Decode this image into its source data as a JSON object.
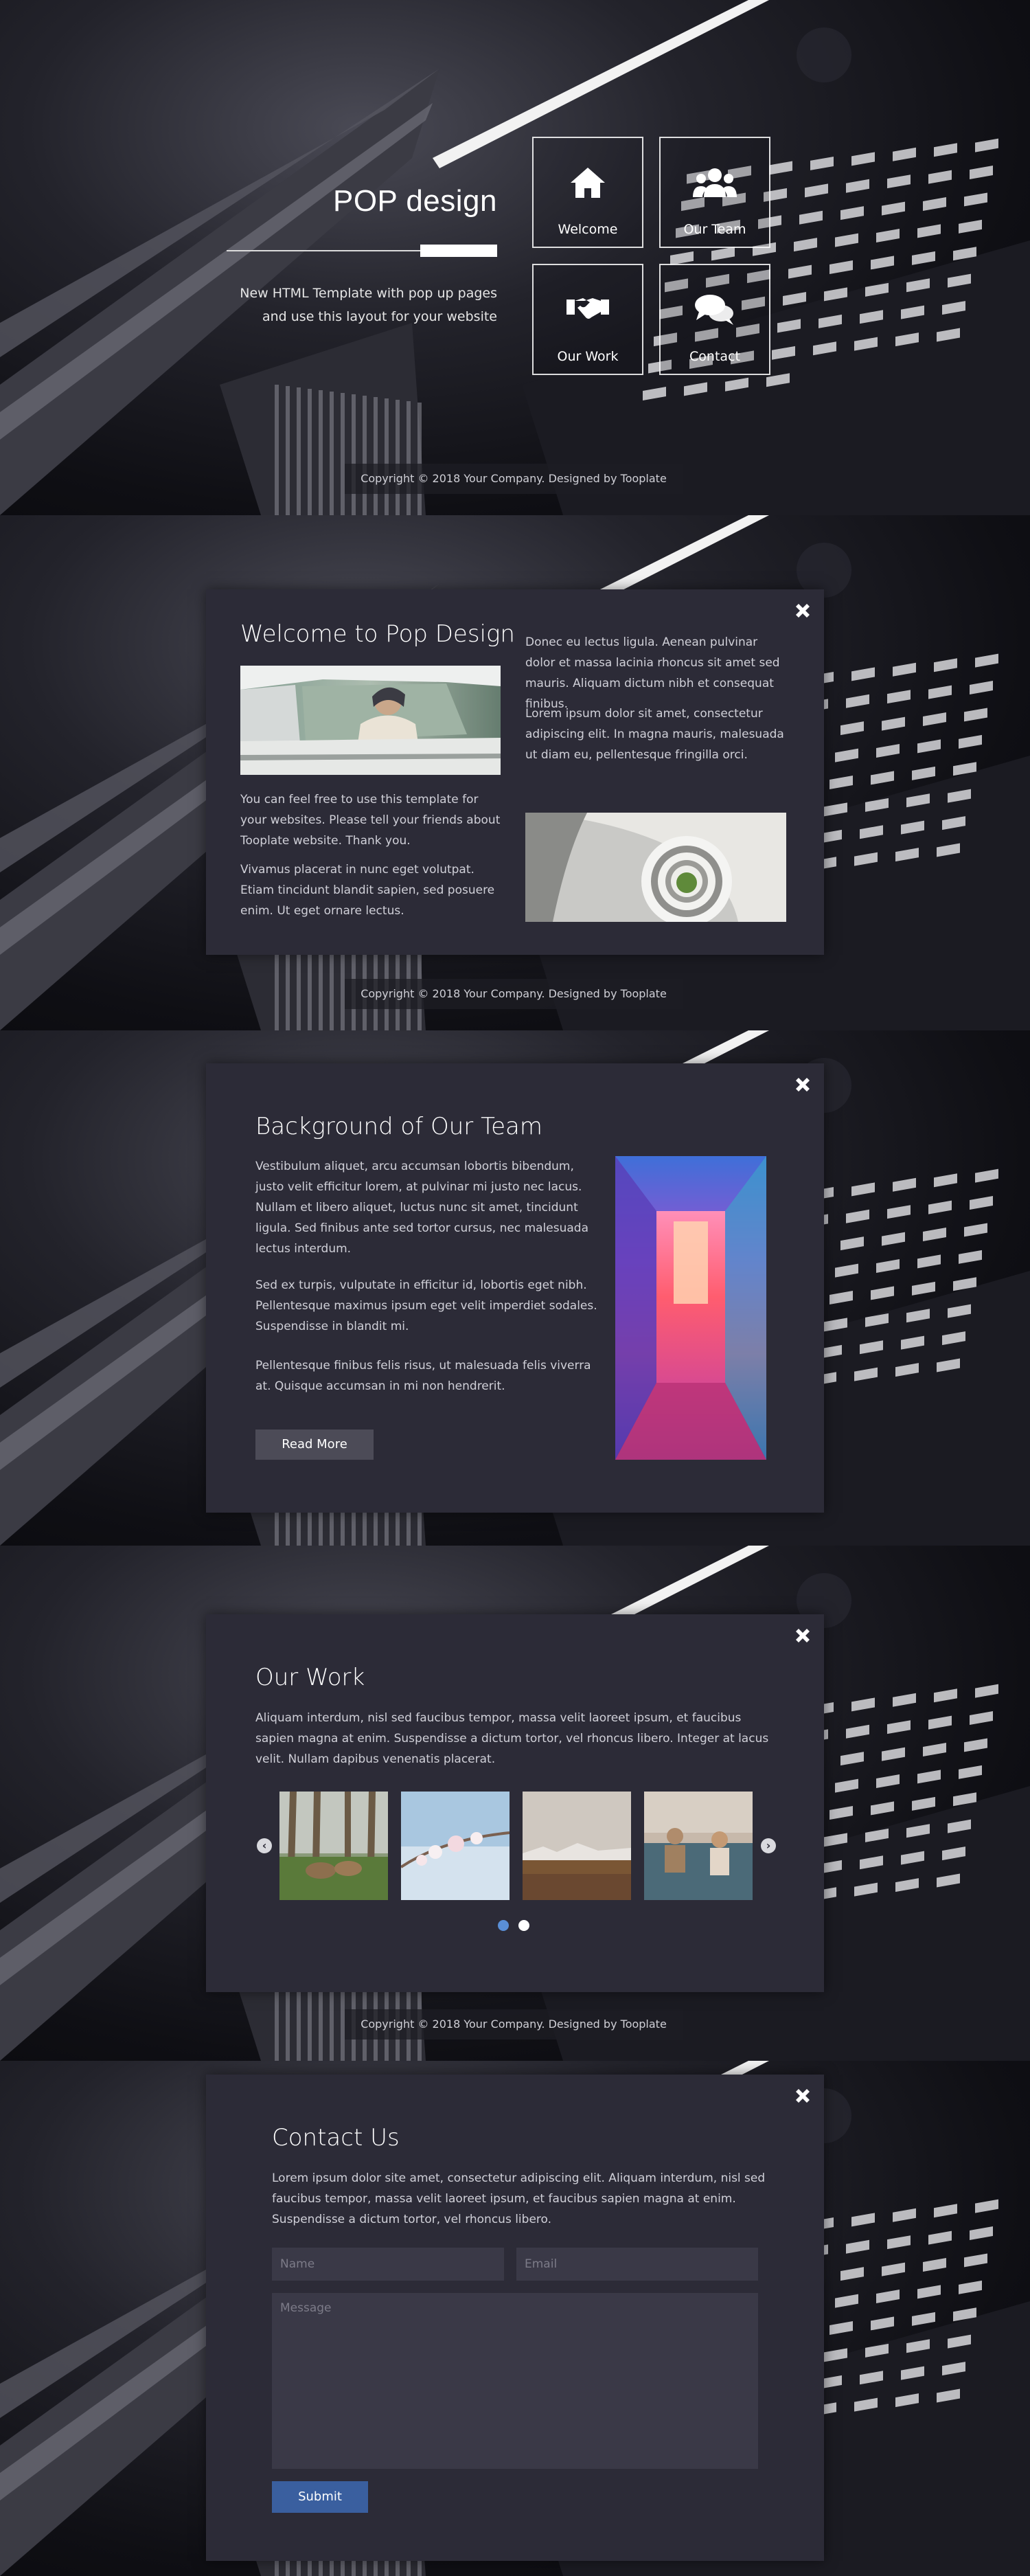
{
  "hero": {
    "title": "POP design",
    "subtitle_line1": "New HTML Template with pop up pages",
    "subtitle_line2": "and use this layout for your website",
    "tiles": [
      {
        "label": "Welcome",
        "icon": "home-icon"
      },
      {
        "label": "Our Team",
        "icon": "users-icon"
      },
      {
        "label": "Our Work",
        "icon": "handshake-icon"
      },
      {
        "label": "Contact",
        "icon": "comments-icon"
      }
    ]
  },
  "footer": {
    "copyright": "Copyright © 2018 Your Company. Designed by Tooplate"
  },
  "welcome": {
    "title": "Welcome to Pop Design",
    "left_p1": "You can feel free to use this template for your websites. Please tell your friends about Tooplate website. Thank you.",
    "left_p2": "Vivamus placerat in nunc eget volutpat. Etiam tincidunt blandit sapien, sed posuere enim. Ut eget ornare lectus.",
    "right_p1": "Donec eu lectus ligula. Aenean pulvinar dolor et massa lacinia rhoncus sit amet sed mauris. Aliquam dictum nibh et consequat finibus.",
    "right_p2": "Lorem ipsum dolor sit amet, consectetur adipiscing elit. In magna mauris, malesuada ut diam eu, pellentesque fringilla orci."
  },
  "team": {
    "title": "Background of Our Team",
    "p1": "Vestibulum aliquet, arcu accumsan lobortis bibendum, justo velit efficitur lorem, at pulvinar mi justo nec lacus. Nullam et libero aliquet, luctus nunc sit amet, tincidunt ligula. Sed finibus ante sed tortor cursus, nec malesuada lectus interdum.",
    "p2": "Sed ex turpis, vulputate in efficitur id, lobortis eget nibh. Pellentesque maximus ipsum eget velit imperdiet sodales. Suspendisse in blandit mi.",
    "p3": "Pellentesque finibus felis risus, ut malesuada felis viverra at. Quisque accumsan in mi non hendrerit.",
    "button": "Read More"
  },
  "work": {
    "title": "Our Work",
    "p1": "Aliquam interdum, nisl sed faucibus tempor, massa velit laoreet ipsum, et faucibus sapien magna at enim. Suspendisse a dictum tortor, vel rhoncus libero. Integer at lacus velit. Nullam dapibus venenatis placerat.",
    "prev": "‹",
    "next": "›",
    "active_dot_color": "#5a8fd6",
    "inactive_dot_color": "#ffffff"
  },
  "contact": {
    "title": "Contact Us",
    "p1": "Lorem ipsum dolor site amet, consectetur adipiscing elit. Aliquam interdum, nisl sed faucibus tempor, massa velit laoreet ipsum, et faucibus sapien magna at enim. Suspendisse a dictum tortor, vel rhoncus libero.",
    "name_placeholder": "Name",
    "email_placeholder": "Email",
    "message_placeholder": "Message",
    "submit": "Submit",
    "submit_color": "#3a5f9f"
  },
  "close_icon": "close-icon",
  "accent": "#5a8fd6"
}
